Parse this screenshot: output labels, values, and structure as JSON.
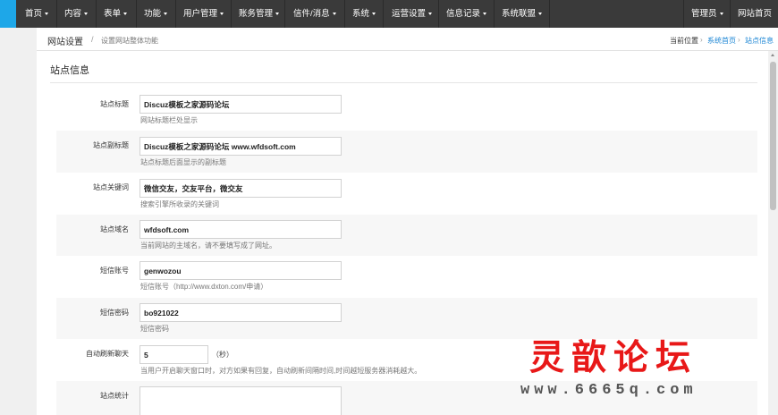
{
  "nav": {
    "items": [
      {
        "label": "首页"
      },
      {
        "label": "内容"
      },
      {
        "label": "表单"
      },
      {
        "label": "功能"
      },
      {
        "label": "用户管理"
      },
      {
        "label": "账务管理"
      },
      {
        "label": "信件/消息"
      },
      {
        "label": "系统"
      },
      {
        "label": "运营设置"
      },
      {
        "label": "信息记录"
      },
      {
        "label": "系统联盟"
      }
    ],
    "right": [
      {
        "label": "管理员"
      },
      {
        "label": "网站首页"
      }
    ]
  },
  "breadcrumb": {
    "title": "网站设置",
    "separator": "/",
    "subtitle": "设置网站整体功能",
    "location_label": "当前位置",
    "home_link": "系统首页",
    "current_link": "站点信息",
    "arrow": "›"
  },
  "section": {
    "title": "站点信息"
  },
  "form": {
    "fields": [
      {
        "label": "站点标题",
        "value": "Discuz模板之家源码论坛",
        "hint": "网站标题栏处显示"
      },
      {
        "label": "站点副标题",
        "value": "Discuz模板之家源码论坛 www.wfdsoft.com",
        "hint": "站点标题后面显示的副标题"
      },
      {
        "label": "站点关键词",
        "value": "微信交友，交友平台，微交友",
        "hint": "搜索引擎所收录的关键词"
      },
      {
        "label": "站点域名",
        "value": "wfdsoft.com",
        "hint": "当前网站的主域名，请不要填写成了网址。"
      },
      {
        "label": "短信账号",
        "value": "genwozou",
        "hint": "短信账号（http://www.dxton.com/申请）"
      },
      {
        "label": "短信密码",
        "value": "bo921022",
        "hint": "短信密码"
      },
      {
        "label": "自动刷新聊天",
        "value": "5",
        "suffix": "（秒）",
        "hint": "当用户开启聊天窗口时，对方如果有回复，自动刷新间隔时间,时间越短服务器消耗越大。"
      },
      {
        "label": "站点统计",
        "value": "",
        "hint": ""
      }
    ]
  },
  "watermark": {
    "title": "灵歆论坛",
    "url": "www.6665q.com"
  }
}
